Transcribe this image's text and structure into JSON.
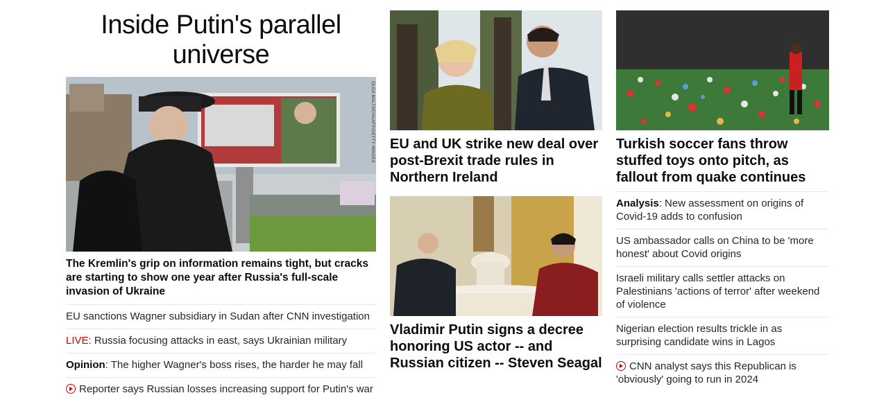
{
  "col1": {
    "headline": "Inside Putin's parallel universe",
    "image_credit": "OLGA MALTSEVA/AFP/GETTY IMAGES",
    "lead_text": "The Kremlin's grip on information remains tight, but cracks are starting to show one year after Russia's full-scale invasion of Ukraine",
    "links": [
      {
        "text": "EU sanctions Wagner subsidiary in Sudan after CNN investigation"
      },
      {
        "prefix": "LIVE:",
        "text": " Russia focusing attacks in east, says Ukrainian military"
      },
      {
        "prefix": "Opinion",
        "text": ": The higher Wagner's boss rises, the harder he may fall"
      },
      {
        "text": "Reporter says Russian losses increasing support for Putin's war"
      }
    ]
  },
  "col2": {
    "story1": "EU and UK strike new deal over post-Brexit trade rules in Northern Ireland",
    "story2": "Vladimir Putin signs a decree honoring US actor -- and Russian citizen -- Steven Seagal"
  },
  "col3": {
    "story1": "Turkish soccer fans throw stuffed toys onto pitch, as fallout from quake continues",
    "links": [
      {
        "prefix": "Analysis",
        "text": ": New assessment on origins of Covid-19 adds to confusion"
      },
      {
        "text": "US ambassador calls on China to be 'more honest' about Covid origins"
      },
      {
        "text": "Israeli military calls settler attacks on Palestinians 'actions of terror' after weekend of violence"
      },
      {
        "text": "Nigerian election results trickle in as surprising candidate wins in Lagos"
      },
      {
        "text": "CNN analyst says this Republican is 'obviously' going to run in 2024"
      }
    ]
  },
  "colors": {
    "live": "#cc0000",
    "divider": "#e6e6e6"
  }
}
